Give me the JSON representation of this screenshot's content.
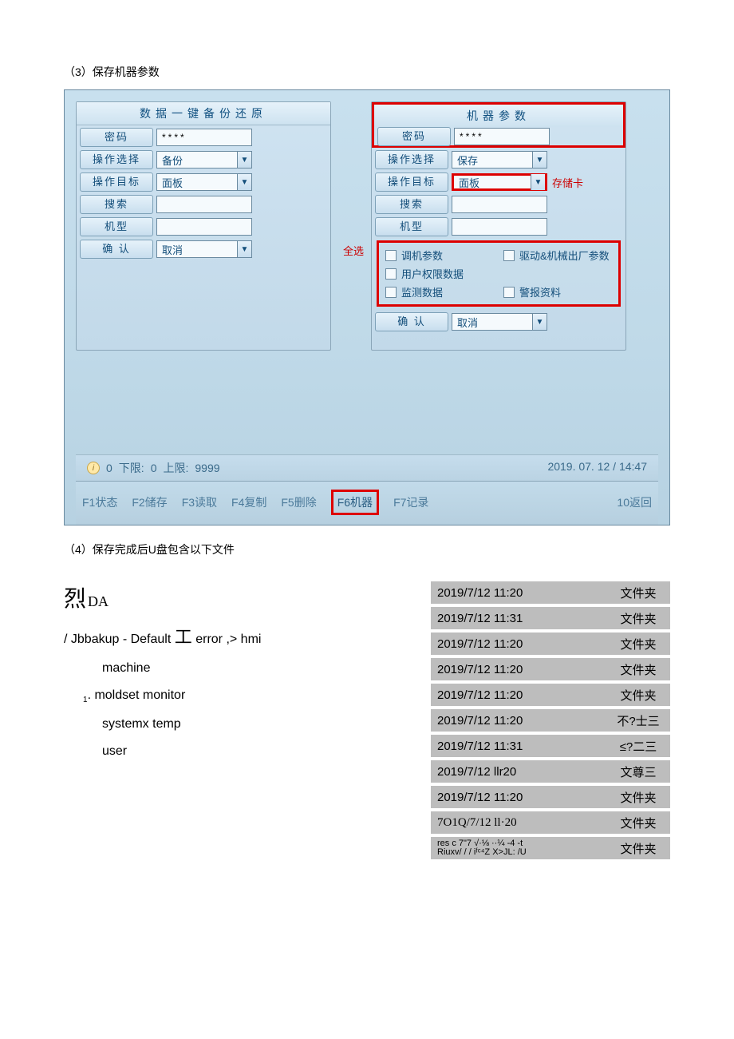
{
  "caption3": "（3）保存机器参数",
  "caption4": "（4）保存完成后U盘包含以下文件",
  "left_panel": {
    "title": "数据一键备份还原",
    "password_label": "密码",
    "password_mask": "****",
    "op_select_label": "操作选择",
    "op_select_value": "备份",
    "op_target_label": "操作目标",
    "op_target_value": "面板",
    "search_label": "搜索",
    "model_label": "机型",
    "confirm_label": "确 认",
    "cancel_value": "取消"
  },
  "right_panel": {
    "title": "机器参数",
    "password_label": "密码",
    "password_mask": "****",
    "op_select_label": "操作选择",
    "op_select_value": "保存",
    "op_target_label": "操作目标",
    "op_target_value": "面板",
    "storage_note": "存储卡",
    "search_label": "搜索",
    "model_label": "机型",
    "select_all": "全选",
    "checkboxes": {
      "c1": "调机参数",
      "c2": "驱动&机械出厂参数",
      "c3": "用户权限数据",
      "c4": "监测数据",
      "c5": "警报资料"
    },
    "confirm_label": "确 认",
    "cancel_value": "取消"
  },
  "status": {
    "left_num": "0",
    "lower_label": "下限:",
    "lower_val": "0",
    "upper_label": "上限:",
    "upper_val": "9999",
    "datetime": "2019. 07. 12 / 14:47"
  },
  "fkeys": {
    "f1": "F1状态",
    "f2": "F2储存",
    "f3": "F3读取",
    "f4": "F4复制",
    "f5": "F5删除",
    "f6": "F6机器",
    "f7": "F7记录",
    "f10": "10返回"
  },
  "file_left": {
    "hdr_big": "烈",
    "hdr_sub": "DA",
    "line1_a": "/ Jbbakup - Default ",
    "line1_gong": "工",
    "line1_b": "  error ,> hmi",
    "indent1": "machine",
    "indent2_num": "1",
    "indent2_text": ". moldset  monitor",
    "indent3": "systemx temp",
    "indent4": "user"
  },
  "file_rows": [
    {
      "date": "2019/7/12 11:20",
      "type": "文件夹"
    },
    {
      "date": "2019/7/12 11:31",
      "type": "文件夹"
    },
    {
      "date": "2019/7/12 11:20",
      "type": "文件夹"
    },
    {
      "date": "2019/7/12 11:20",
      "type": "文件夹"
    },
    {
      "date": "2019/7/12 11:20",
      "type": "文件夹"
    },
    {
      "date": "2019/7/12 11:20",
      "type": "不?士三"
    },
    {
      "date": "2019/7/12 11:31",
      "type": "≤?二三"
    },
    {
      "date": "2019/7/12 llr20",
      "type": "文尊三"
    },
    {
      "date": "2019/7/12 11:20",
      "type": "文件夹"
    },
    {
      "date": "7O1Q/7/12 ll·20",
      "type": "文件夹",
      "alt": true
    },
    {
      "garble": "res c 7\"7 √·⅛ ··¼ -4 -t\nRiuxv/ / / iᶠᶜ⁴Z X>JL: /U",
      "type": "文件夹"
    }
  ]
}
